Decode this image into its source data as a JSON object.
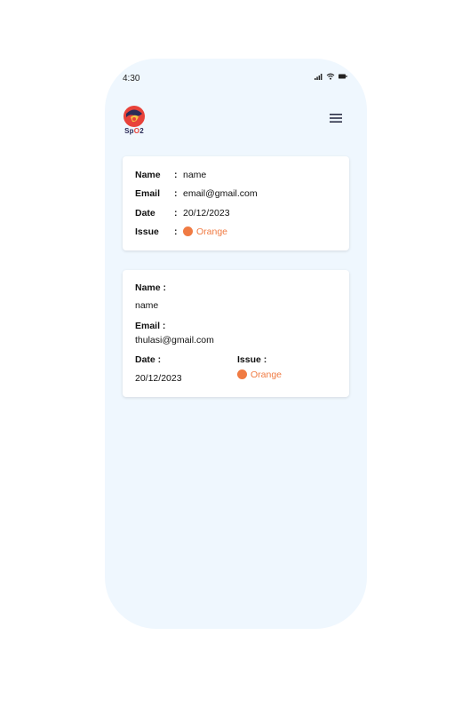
{
  "status": {
    "time": "4:30"
  },
  "logo": {
    "text_prefix": "Sp",
    "text_o": "O",
    "text_suffix": "2"
  },
  "card1": {
    "rows": [
      {
        "label": "Name",
        "colon": ":",
        "value": "name"
      },
      {
        "label": "Email",
        "colon": ":",
        "value": "email@gmail.com"
      },
      {
        "label": "Date",
        "colon": ":",
        "value": "20/12/2023"
      },
      {
        "label": "Issue",
        "colon": ":",
        "value": "Orange"
      }
    ]
  },
  "card2": {
    "name_label": "Name :",
    "name_value": "name",
    "email_label": "Email :",
    "email_value": "thulasi@gmail.com",
    "date_label": "Date :",
    "date_value": "20/12/2023",
    "issue_label": "Issue :",
    "issue_value": "Orange"
  },
  "colors": {
    "background": "#eff7fe",
    "issue": "#f07b43",
    "card": "#ffffff"
  }
}
